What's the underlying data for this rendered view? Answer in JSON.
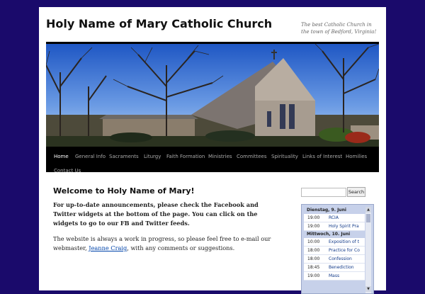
{
  "site": {
    "title": "Holy Name of Mary Catholic Church",
    "description": "The best Catholic Church in the town of Bedford, Virginia!"
  },
  "nav": {
    "items": [
      {
        "label": "Home",
        "active": true
      },
      {
        "label": "General Info"
      },
      {
        "label": "Sacraments"
      },
      {
        "label": "Liturgy"
      },
      {
        "label": "Faith Formation"
      },
      {
        "label": "Ministries"
      },
      {
        "label": "Committees"
      },
      {
        "label": "Spirituality"
      },
      {
        "label": "Links of Interest"
      },
      {
        "label": "Homilies"
      },
      {
        "label": "Contact Us"
      }
    ]
  },
  "main": {
    "heading": "Welcome to Holy Name of Mary!",
    "announcement": "For up-to-date announcements, please check the Facebook and Twitter widgets at the bottom of the page.  You can click on the widgets to go to our FB and Twitter feeds.",
    "progress_text_before": "The website is always a work in progress, so please feel free to e-mail our webmaster, ",
    "webmaster_name": "Jeanne Craig",
    "progress_text_after": ", with any comments or suggestions."
  },
  "search": {
    "placeholder": "",
    "button_label": "Search"
  },
  "calendar": {
    "days": [
      {
        "label": "Dienstag, 9. Juni",
        "events": [
          {
            "time": "19:00",
            "name": "RCIA"
          },
          {
            "time": "19:00",
            "name": "Holy Spirit Pra"
          }
        ]
      },
      {
        "label": "Mittwoch, 10. Juni",
        "events": [
          {
            "time": "10:00",
            "name": "Exposition of t"
          },
          {
            "time": "18:00",
            "name": "Practice for Co"
          },
          {
            "time": "18:00",
            "name": "Confession"
          },
          {
            "time": "18:45",
            "name": "Benediction"
          },
          {
            "time": "19:00",
            "name": "Mass"
          }
        ]
      }
    ]
  },
  "colors": {
    "background": "#1a0a6b",
    "nav_bg": "#000000",
    "link": "#0044aa",
    "calendar_bg": "#c7d1ea"
  }
}
